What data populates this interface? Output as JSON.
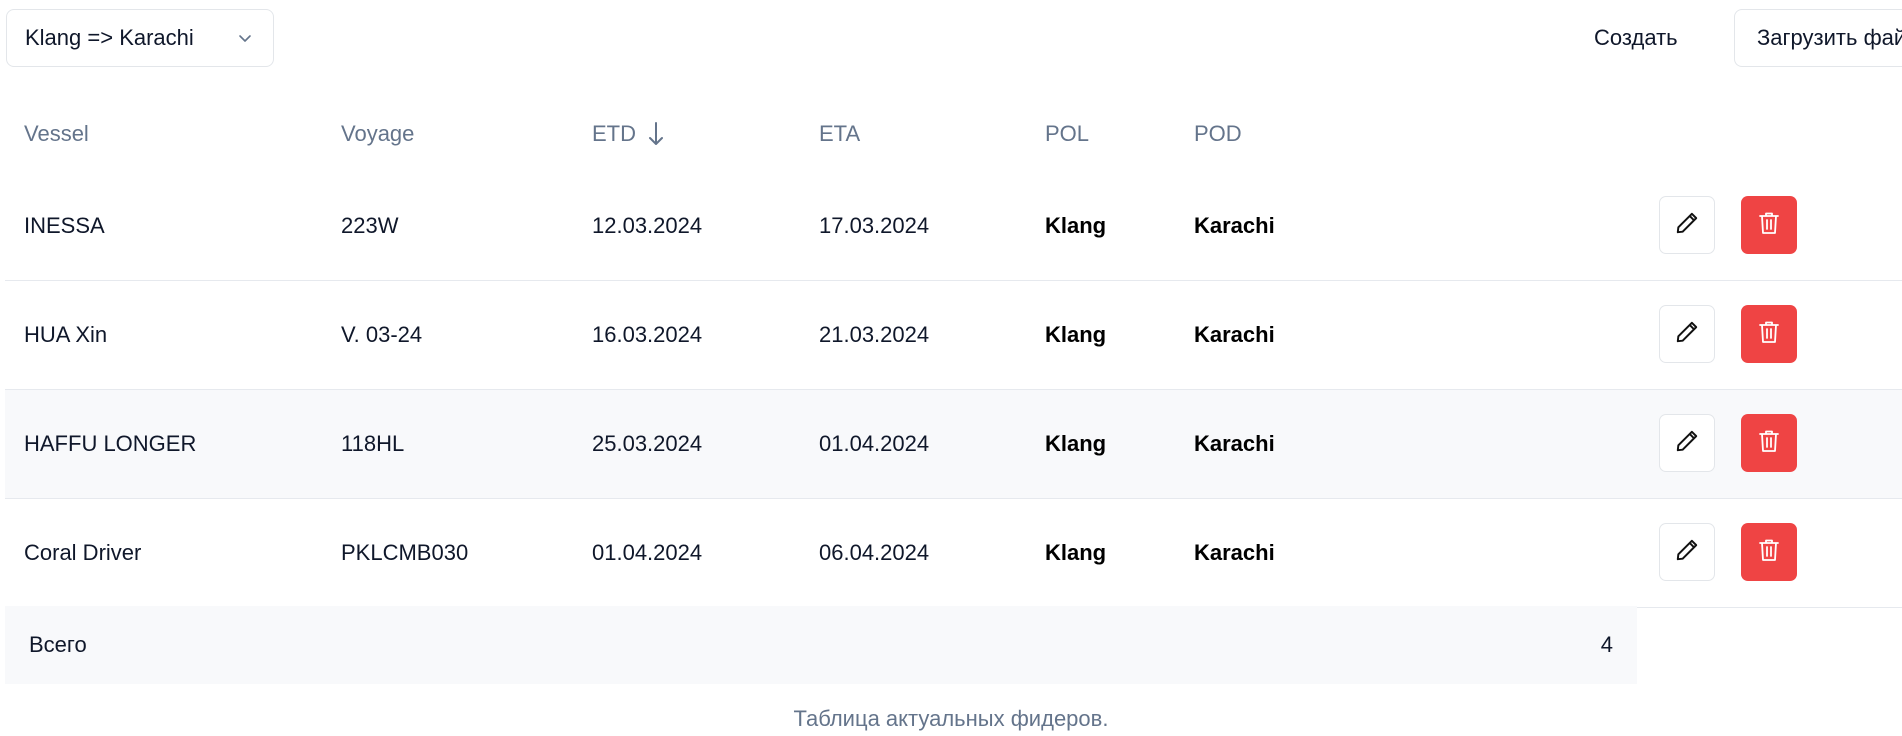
{
  "toolbar": {
    "route_select_value": "Klang => Karachi",
    "create_label": "Создать",
    "upload_label": "Загрузить фай"
  },
  "table": {
    "headers": {
      "vessel": "Vessel",
      "voyage": "Voyage",
      "etd": "ETD",
      "eta": "ETA",
      "pol": "POL",
      "pod": "POD"
    },
    "sort": {
      "column": "ETD",
      "direction": "descending"
    },
    "rows": [
      {
        "vessel": "INESSA",
        "voyage": "223W",
        "etd": "12.03.2024",
        "eta": "17.03.2024",
        "pol": "Klang",
        "pod": "Karachi"
      },
      {
        "vessel": "HUA Xin",
        "voyage": "V. 03-24",
        "etd": "16.03.2024",
        "eta": "21.03.2024",
        "pol": "Klang",
        "pod": "Karachi"
      },
      {
        "vessel": "HAFFU LONGER",
        "voyage": "118HL",
        "etd": "25.03.2024",
        "eta": "01.04.2024",
        "pol": "Klang",
        "pod": "Karachi"
      },
      {
        "vessel": "Coral Driver",
        "voyage": "PKLCMB030",
        "etd": "01.04.2024",
        "eta": "06.04.2024",
        "pol": "Klang",
        "pod": "Karachi"
      }
    ],
    "total_label": "Всего",
    "total_value": "4",
    "caption": "Таблица актуальных фидеров."
  },
  "icons": {
    "chevron": "chevron-down-icon",
    "sort": "arrow-down-icon",
    "edit": "pencil-icon",
    "delete": "trash-icon"
  },
  "colors": {
    "delete_button": "#ef4444",
    "header_text": "#64748b",
    "highlight_row": "#f8f9fb",
    "border": "#e6e9ee"
  }
}
